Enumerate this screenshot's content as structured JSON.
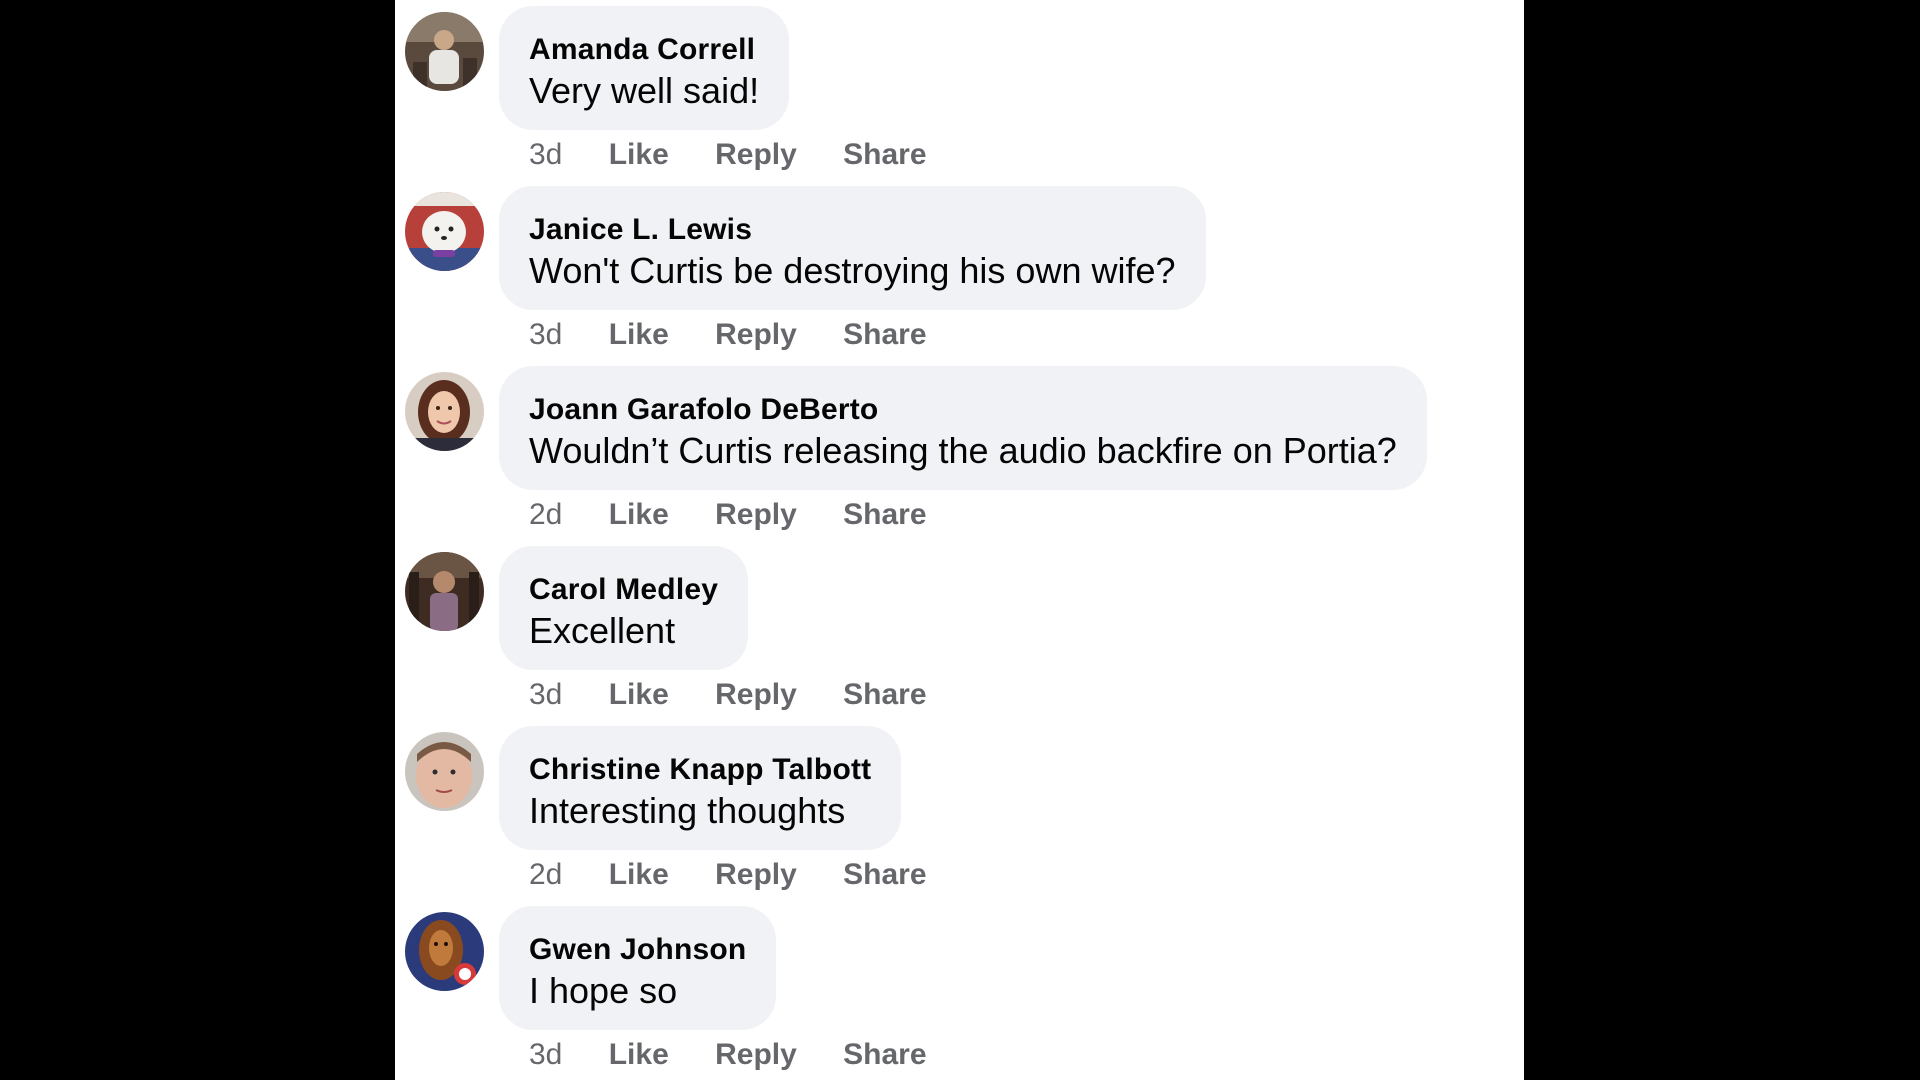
{
  "colors": {
    "page_background": "#000000",
    "panel_background": "#ffffff",
    "bubble_background": "#f0f2f5",
    "author_color": "#050505",
    "meta_color": "#65676b"
  },
  "comments": [
    {
      "author": "Amanda Correll",
      "text": "Very well said!",
      "time": "3d",
      "like": "Like",
      "reply": "Reply",
      "share": "Share",
      "avatar_icon": "profile-photo"
    },
    {
      "author": "Janice L. Lewis",
      "text": "Won't Curtis be destroying his own wife?",
      "time": "3d",
      "like": "Like",
      "reply": "Reply",
      "share": "Share",
      "avatar_icon": "profile-photo"
    },
    {
      "author": "Joann Garafolo DeBerto",
      "text": "Wouldn’t Curtis releasing the audio backfire on Portia?",
      "time": "2d",
      "like": "Like",
      "reply": "Reply",
      "share": "Share",
      "avatar_icon": "profile-photo"
    },
    {
      "author": "Carol Medley",
      "text": "Excellent",
      "time": "3d",
      "like": "Like",
      "reply": "Reply",
      "share": "Share",
      "avatar_icon": "profile-photo"
    },
    {
      "author": "Christine Knapp Talbott",
      "text": "Interesting thoughts",
      "time": "2d",
      "like": "Like",
      "reply": "Reply",
      "share": "Share",
      "avatar_icon": "profile-photo"
    },
    {
      "author": "Gwen Johnson",
      "text": "I hope so",
      "time": "3d",
      "like": "Like",
      "reply": "Reply",
      "share": "Share",
      "avatar_icon": "profile-photo"
    }
  ]
}
